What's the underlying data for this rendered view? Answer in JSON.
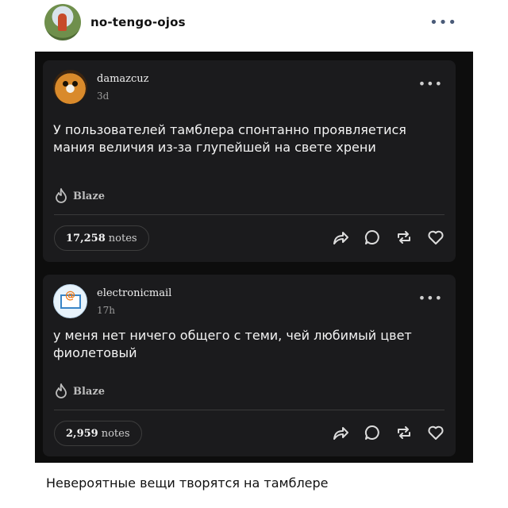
{
  "header": {
    "username": "no-tengo-ojos",
    "more_icon": "•••"
  },
  "posts": [
    {
      "username": "damazcuz",
      "time": "3d",
      "more_icon": "•••",
      "text": "У пользователей тамблера спонтанно проявляетися мания величия из-за глупейшей на свете хрени",
      "blaze_label": "Blaze",
      "notes_count": "17,258",
      "notes_label": "notes"
    },
    {
      "username": "electronicmail",
      "time": "17h",
      "more_icon": "•••",
      "text": "у меня нет ничего общего с теми, чей любимый цвет фиолетовый",
      "blaze_label": "Blaze",
      "notes_count": "2,959",
      "notes_label": "notes",
      "avatar_glyph": "@"
    }
  ],
  "caption": "Невероятные вещи творятся на тамблере"
}
